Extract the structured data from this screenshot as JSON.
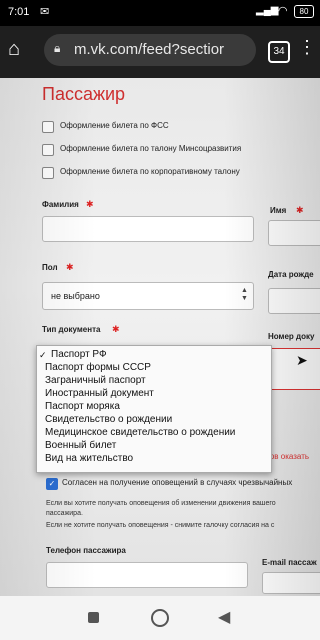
{
  "status": {
    "time": "7:01",
    "battery": "80"
  },
  "browser": {
    "url": "m.vk.com/feed?sectior",
    "tab_count": "34"
  },
  "form": {
    "title": "Пассажир",
    "checkboxes": [
      "Оформление билета по ФСС",
      "Оформление билета по талону Минсоцразвития",
      "Оформление билета по корпоративному талону"
    ],
    "surname_label": "Фамилия",
    "name_label": "Имя",
    "gender_label": "Пол",
    "gender_value": "не выбрано",
    "birth_label": "Дата рожде",
    "doc_type_label": "Тип документа",
    "doc_number_label": "Номер доку",
    "error_hint": "отов оказать",
    "consent_label": "Согласен на получение оповещений в случаях чрезвычайных",
    "note1": "Если вы хотите получать оповещения об изменении движения вашего",
    "note1b": "пассажира.",
    "note2": "Если не хотите получать оповещения - снимите галочку согласия на с",
    "phone_label": "Телефон пассажира",
    "email_label": "E-mail пассаж"
  },
  "dropdown": {
    "options": [
      "Паспорт РФ",
      "Паспорт формы СССР",
      "Заграничный паспорт",
      "Иностранный документ",
      "Паспорт моряка",
      "Свидетельство о рождении",
      "Медицинское свидетельство о рождении",
      "Военный билет",
      "Вид на жительство"
    ],
    "selected_mark": "✓"
  }
}
